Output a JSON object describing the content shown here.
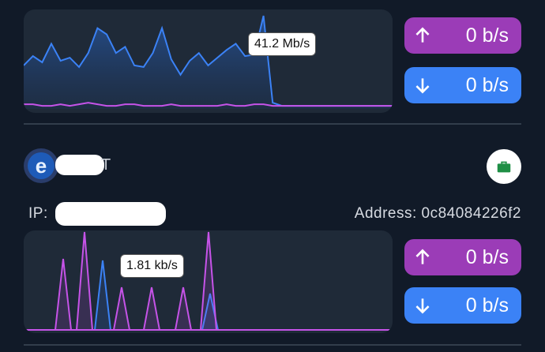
{
  "device_top": {
    "rate_tooltip": "41.2 Mb/s",
    "upload": "0 b/s",
    "download": "0 b/s",
    "series_blue": [
      28,
      34,
      30,
      42,
      31,
      33,
      27,
      36,
      52,
      48,
      36,
      40,
      28,
      27,
      36,
      52,
      32,
      22,
      31,
      36,
      28,
      33,
      38,
      42,
      34,
      35,
      53,
      4,
      2,
      2,
      2,
      2,
      2,
      2,
      2,
      2,
      2,
      2,
      2,
      2,
      2
    ],
    "series_purple": [
      3,
      3,
      2,
      2,
      3,
      2,
      3,
      4,
      3,
      2,
      2,
      3,
      3,
      2,
      2,
      2,
      3,
      2,
      2,
      2,
      2,
      2,
      3,
      2,
      2,
      3,
      3,
      2,
      2,
      2,
      2,
      2,
      2,
      2,
      2,
      2,
      2,
      2,
      2,
      2,
      2
    ]
  },
  "device_second": {
    "name_visible_suffix": "T",
    "ip_label": "IP:",
    "address_label": "Address: 0c84084226f2",
    "rate_tooltip": "1.81 kb/s",
    "upload": "0 b/s",
    "download": "0 b/s"
  },
  "colors": {
    "upload": "#9b3cb7",
    "download": "#3b82f6",
    "background": "#111a28",
    "panel": "#1f2a38"
  },
  "icons": {
    "device_icon": "edge-browser-icon",
    "status": "briefcase-icon"
  }
}
